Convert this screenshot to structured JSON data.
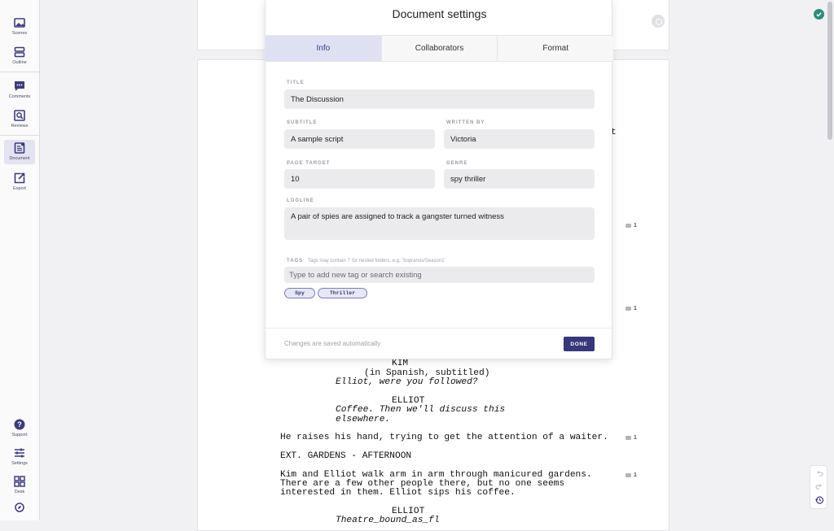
{
  "sidebar": {
    "top_items": [
      {
        "label": "Scenes",
        "icon": "image-icon"
      },
      {
        "label": "Outline",
        "icon": "outline-icon"
      },
      {
        "label": "Comments",
        "icon": "comment-icon"
      },
      {
        "label": "Reviews",
        "icon": "review-icon"
      },
      {
        "label": "Document",
        "icon": "document-icon",
        "active": true
      },
      {
        "label": "Export",
        "icon": "export-icon"
      }
    ],
    "bottom_items": [
      {
        "label": "Support",
        "icon": "help-icon"
      },
      {
        "label": "Settings",
        "icon": "sliders-icon"
      },
      {
        "label": "Desk",
        "icon": "grid-icon"
      }
    ]
  },
  "modal": {
    "title": "Document settings",
    "tabs": [
      {
        "label": "Info",
        "active": true
      },
      {
        "label": "Collaborators"
      },
      {
        "label": "Format"
      }
    ],
    "fields": {
      "title_label": "TITLE",
      "title_value": "The Discussion",
      "subtitle_label": "SUBTITLE",
      "subtitle_value": "A sample script",
      "written_by_label": "WRITTEN BY",
      "written_by_value": "Victoria",
      "page_target_label": "PAGE TARGET",
      "page_target_value": "10",
      "genre_label": "GENRE",
      "genre_value": "spy thriller",
      "logline_label": "LOGLINE",
      "logline_value": "A pair of spies are assigned to track a gangster turned witness",
      "tags_label": "TAGS",
      "tags_hint": "Tags may contain '/' for nested folders, e.g. 'Sopranos/Season1'",
      "tags_placeholder": "Type to add new tag or search existing",
      "tags": [
        "Spy",
        "Thriller"
      ]
    },
    "footer": {
      "autosave_text": "Changes are saved automatically",
      "done_label": "DONE"
    }
  },
  "script": {
    "kim_character": "KIM",
    "kim_paren": "(in Spanish, subtitled)",
    "kim_line": "Elliot, were you followed?",
    "elliot_character": "ELLIOT",
    "elliot_line_1": "Coffee. Then we'll discuss this",
    "elliot_line_2": "elsewhere.",
    "action_1": "He raises his hand, trying to get the attention of a waiter.",
    "scene_heading": "EXT. GARDENS - AFTERNOON",
    "action_2_line_1": "Kim and Elliot walk arm in arm through manicured gardens.",
    "action_2_line_2": "There are a few other people there, but no one seems",
    "action_2_line_3": "interested in them. Elliot sips his coffee.",
    "elliot_character_2": "ELLIOT",
    "elliot_line_3": "Theatre_bound_as_fl",
    "comment_counts": [
      "1",
      "1",
      "1",
      "1"
    ],
    "stray_char": "t"
  },
  "colors": {
    "accent": "#373779",
    "active_tab": "#e0e0f3",
    "saved_status": "#2d8c7c"
  }
}
